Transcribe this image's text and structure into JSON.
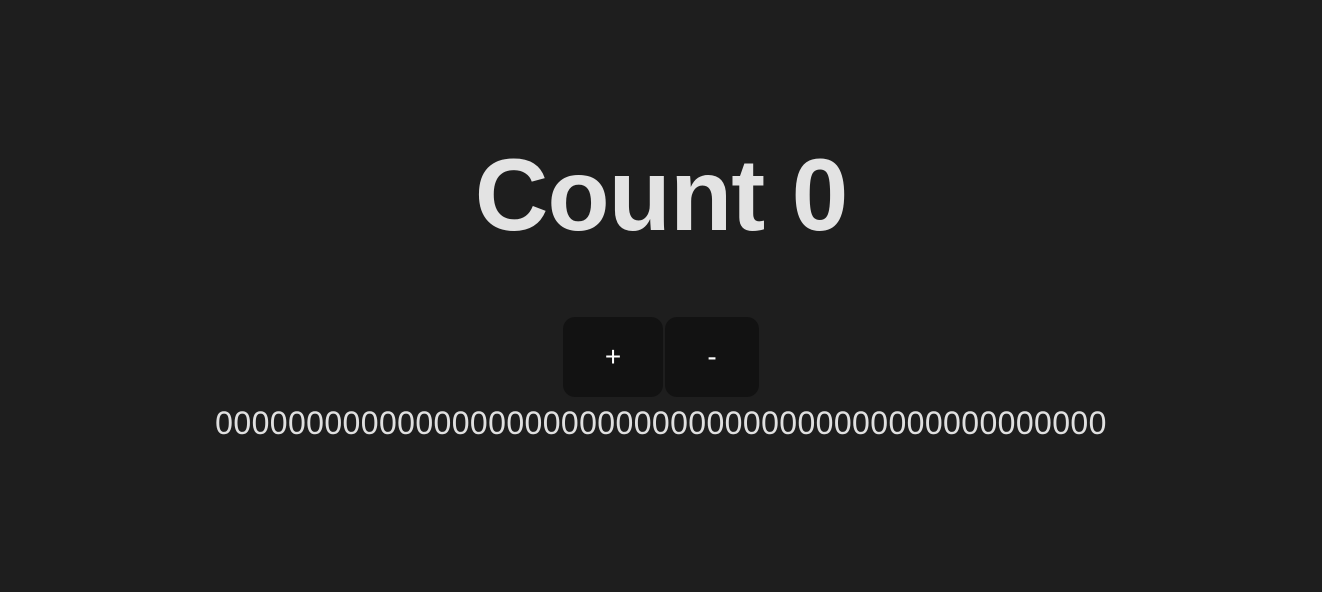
{
  "counter": {
    "title": "Count 0",
    "increment_label": "+",
    "decrement_label": "-",
    "history": "0000000000000000000000000000000000000000000000000"
  },
  "colors": {
    "background": "#1e1e1e",
    "button_background": "#121212",
    "text": "#e0e0e0"
  }
}
